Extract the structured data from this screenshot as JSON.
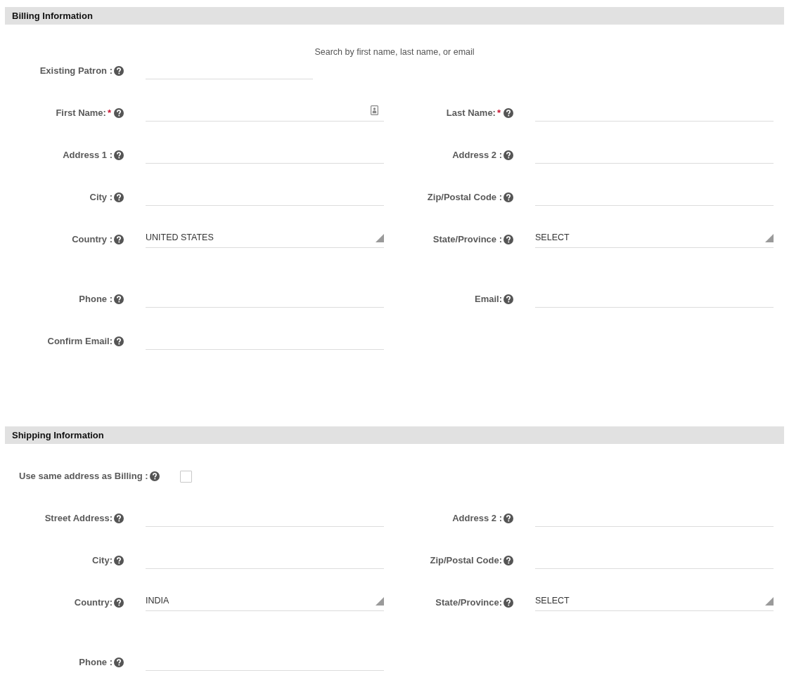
{
  "billing": {
    "title": "Billing Information",
    "search_hint": "Search by first name, last name, or email",
    "rows": [
      [
        {
          "label": "Existing Patron :",
          "field": {
            "kind": "search"
          }
        }
      ],
      [
        {
          "label": "First Name:",
          "required_mark": "*",
          "field": {
            "kind": "card"
          }
        },
        {
          "label": "Last Name:",
          "required_mark": "*",
          "field": {
            "kind": "text"
          }
        }
      ],
      [
        {
          "label": "Address 1 :",
          "field": {
            "kind": "text"
          }
        },
        {
          "label": "Address 2 :",
          "field": {
            "kind": "text"
          }
        }
      ],
      [
        {
          "label": "City :",
          "field": {
            "kind": "text"
          }
        },
        {
          "label": "Zip/Postal Code :",
          "field": {
            "kind": "text"
          }
        }
      ],
      [
        {
          "label": "Country :",
          "field": {
            "kind": "select",
            "value": "UNITED STATES"
          }
        },
        {
          "label": "State/Province :",
          "field": {
            "kind": "select",
            "value": "SELECT"
          }
        }
      ],
      [
        {
          "label": "Phone :",
          "field": {
            "kind": "text"
          }
        },
        {
          "label": "Email:",
          "field": {
            "kind": "text"
          }
        }
      ],
      [
        {
          "label": "Confirm Email:",
          "field": {
            "kind": "text"
          }
        }
      ]
    ]
  },
  "shipping": {
    "title": "Shipping Information",
    "same_as_billing": {
      "label": "Use same address as Billing :",
      "checked": false
    },
    "rows": [
      [
        {
          "label": "Street Address:",
          "field": {
            "kind": "text"
          }
        },
        {
          "label": "Address 2 :",
          "field": {
            "kind": "text"
          }
        }
      ],
      [
        {
          "label": "City:",
          "field": {
            "kind": "text"
          }
        },
        {
          "label": "Zip/Postal Code:",
          "field": {
            "kind": "text"
          }
        }
      ],
      [
        {
          "label": "Country:",
          "field": {
            "kind": "select",
            "value": "INDIA"
          }
        },
        {
          "label": "State/Province:",
          "field": {
            "kind": "select",
            "value": "SELECT"
          }
        }
      ],
      [
        {
          "label": "Phone :",
          "field": {
            "kind": "text"
          }
        }
      ]
    ]
  }
}
